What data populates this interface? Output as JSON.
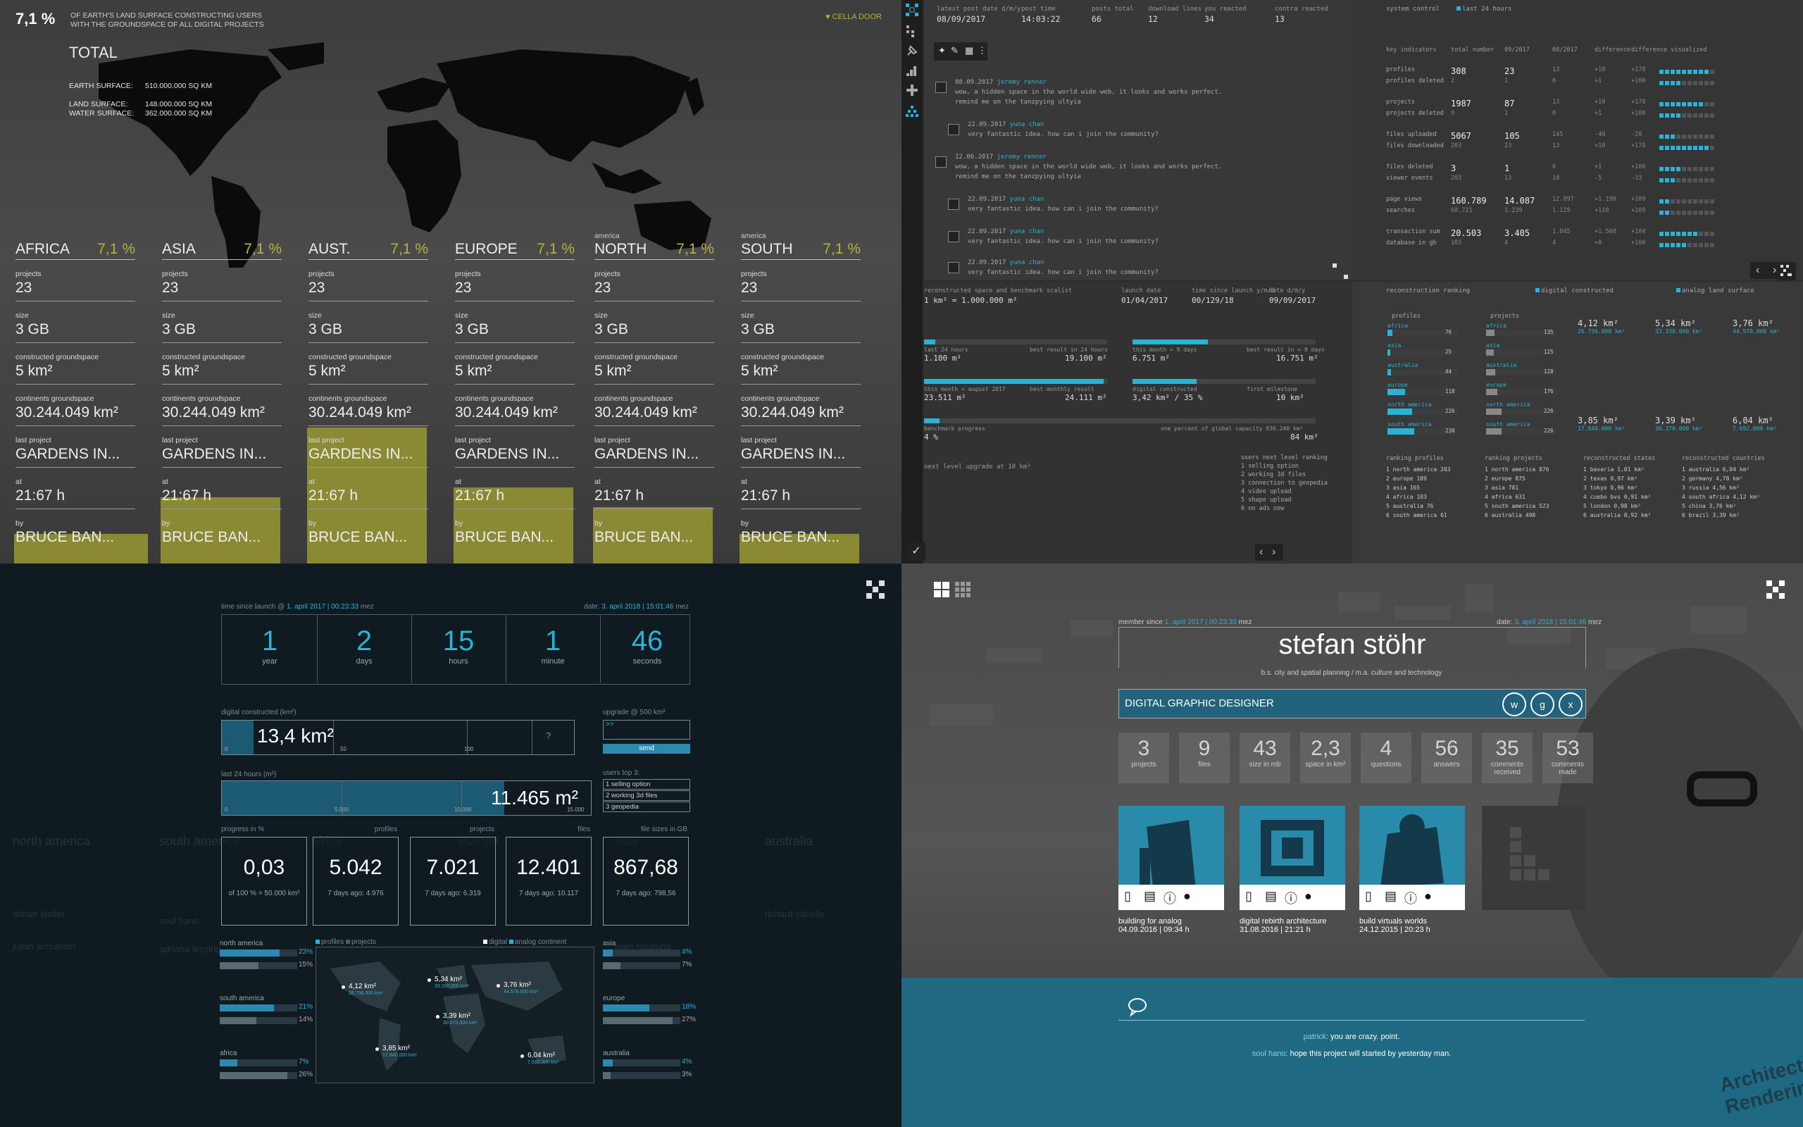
{
  "q1": {
    "pct": "7,1 %",
    "desc": [
      "OF EARTH'S LAND SURFACE CONSTRUCTING USERS",
      "WITH THE GROUNDSPACE OF ALL DIGITAL PROJECTS"
    ],
    "brand": "CELLA DOOR",
    "total": "TOTAL",
    "earth_label": "EARTH SURFACE:",
    "earth_val": "510.000.000 SQ KM",
    "land_label": "LAND SURFACE:",
    "land_val": "148.000.000 SQ KM",
    "water_label": "WATER SURFACE:",
    "water_val": "362.000.000 SQ KM",
    "continents": [
      {
        "pre": "",
        "name": "AFRICA",
        "pct": "7,1 %"
      },
      {
        "pre": "",
        "name": "ASIA",
        "pct": "7,1 %"
      },
      {
        "pre": "",
        "name": "AUST.",
        "pct": "7,1 %"
      },
      {
        "pre": "",
        "name": "EUROPE",
        "pct": "7,1 %"
      },
      {
        "pre": "america",
        "name": "NORTH",
        "pct": "7,1 %"
      },
      {
        "pre": "america",
        "name": "SOUTH",
        "pct": "7,1 %"
      }
    ],
    "fields": [
      {
        "label": "projects",
        "value": "23"
      },
      {
        "label": "size",
        "value": "3 GB"
      },
      {
        "label": "constructed groundspace",
        "value": "5 km²"
      },
      {
        "label": "continents groundspace",
        "value": "30.244.049 km²"
      },
      {
        "label": "last project",
        "value": "GARDENS IN..."
      },
      {
        "label": "at",
        "value": "21:67 h"
      },
      {
        "label": "by",
        "value": "BRUCE BAN..."
      }
    ],
    "bar_levels": [
      0.09,
      0.2,
      0.41,
      0.23,
      0.17,
      0.09
    ]
  },
  "q2": {
    "top_heads": [
      "latest post date d/m/y",
      "post time",
      "posts total",
      "download lines",
      "you reacted",
      "contra reacted"
    ],
    "top_vals": [
      "08/09/2017",
      "14:03:22",
      "66",
      "12",
      "34",
      "13"
    ],
    "messages": [
      {
        "date": "08.09.2017",
        "user": "jeremy renner",
        "text": "wow, a hidden space in the world wide web, it looks and works perfect.",
        "text2": "remind me on the tanzpying ultyia"
      },
      {
        "date": "22.09.2017",
        "user": "yuna chan",
        "text": "very fantastic idea. how can i join the community?",
        "text2": ""
      },
      {
        "date": "12.06.2017",
        "user": "jeremy renner",
        "text": "wow, a hidden space in the world wide web, it looks and works perfect.",
        "text2": "remind me on the tanzpying ultyia"
      },
      {
        "date": "22.09.2017",
        "user": "yuna chan",
        "text": "very fantastic idea. how can i join the community?",
        "text2": ""
      },
      {
        "date": "22.09.2017",
        "user": "yuna chan",
        "text": "very fantastic idea. how can i join the community?",
        "text2": ""
      },
      {
        "date": "22.09.2017",
        "user": "yuna chan",
        "text": "very fantastic idea. how can i join the community?",
        "text2": ""
      }
    ],
    "sys_control": "system control",
    "last_days": "last 24 hours",
    "table_heads": [
      "key indicators",
      "total number",
      "09/2017",
      "08/2017",
      "difference",
      "difference visualized"
    ],
    "table_rows": [
      {
        "k": "profiles",
        "t": "308",
        "a": "23",
        "b": "13",
        "d": "+10",
        "dv": "+178",
        "on": 9
      },
      {
        "k": "profiles deleted",
        "t": "2",
        "a": "1",
        "b": "0",
        "d": "+1",
        "dv": "+100",
        "on": 4
      },
      {
        "k": "projects",
        "t": "1987",
        "a": "87",
        "b": "13",
        "d": "+10",
        "dv": "+178",
        "on": 8
      },
      {
        "k": "projects deleted",
        "t": "9",
        "a": "1",
        "b": "0",
        "d": "+1",
        "dv": "+100",
        "on": 4
      },
      {
        "k": "files uploaded",
        "t": "5067",
        "a": "105",
        "b": "145",
        "d": "-40",
        "dv": "-28",
        "on": 3
      },
      {
        "k": "files downloaded",
        "t": "203",
        "a": "23",
        "b": "13",
        "d": "+10",
        "dv": "+178",
        "on": 9
      },
      {
        "k": "files deleted",
        "t": "3",
        "a": "1",
        "b": "0",
        "d": "+1",
        "dv": "+100",
        "on": 4
      },
      {
        "k": "viewer events",
        "t": "203",
        "a": "13",
        "b": "18",
        "d": "-5",
        "dv": "-33",
        "on": 3
      },
      {
        "k": "page views",
        "t": "160.789",
        "a": "14.087",
        "b": "12.897",
        "d": "+1.190",
        "dv": "+109",
        "on": 2
      },
      {
        "k": "searches",
        "t": "68.721",
        "a": "1.239",
        "b": "1.129",
        "d": "+110",
        "dv": "+109",
        "on": 2
      },
      {
        "k": "transaction sum",
        "t": "20.503",
        "a": "3.405",
        "b": "1.845",
        "d": "+1.560",
        "dv": "+184",
        "on": 7
      },
      {
        "k": "database in gb",
        "t": "103",
        "a": "4",
        "b": "4",
        "d": "+0",
        "dv": "+100",
        "on": 5
      }
    ],
    "bl_heads": [
      "reconstructed space and benchmark scalist",
      "launch date",
      "time since launch y/m/d",
      "date d/m/y"
    ],
    "bl_vals": [
      "1 km² = 1.000.000 m²",
      "01/04/2017",
      "00/129/18",
      "09/09/2017"
    ],
    "bl_rows": [
      {
        "l1": "last 24 hours",
        "r1": "best result in 24 hours",
        "v1": "1.100 m²",
        "w1": "19.100 m²",
        "l2": "this month = 9 days",
        "r2": "best result in = 9 days",
        "v2": "6.751 m²",
        "w2": "16.751 m²",
        "f1": 0.06,
        "f2": 0.41
      },
      {
        "l1": "this month = august 2017",
        "r1": "best monthly result",
        "v1": "23.511 m²",
        "w1": "24.111 m²",
        "l2": "digital constructed",
        "r2": "first milestone",
        "v2": "3,42 km² / 35 %",
        "w2": "10 km²",
        "f1": 0.98,
        "f2": 0.35
      }
    ],
    "benchmark_label": "benchmark progress",
    "benchmark_val": "4 %",
    "global_label": "one percent of global capacity 936.240 km²",
    "global_val": "84 km²",
    "next_upgrade": "next level upgrade at 10 km²",
    "users_ranking_title": "users next level ranking",
    "users_ranking": [
      "1 selling option",
      "2 working 3d files",
      "3 connection to geopedia",
      "4 video upload",
      "5 shape upload",
      "6 no ads now"
    ],
    "br_title": "reconstruction ranking",
    "legend": [
      "digital constructed",
      "analog land surface"
    ],
    "br_cols": [
      {
        "head": "profiles",
        "items": [
          {
            "n": "africa",
            "v": "76",
            "f": 0.07
          },
          {
            "n": "asia",
            "v": "25",
            "f": 0.04
          },
          {
            "n": "australia",
            "v": "44",
            "f": 0.05
          },
          {
            "n": "europe",
            "v": "118",
            "f": 0.25
          },
          {
            "n": "north america",
            "v": "226",
            "f": 0.35
          },
          {
            "n": "south america",
            "v": "230",
            "f": 0.38
          }
        ]
      },
      {
        "head": "projects",
        "items": [
          {
            "n": "africa",
            "v": "135",
            "f": 0.12
          },
          {
            "n": "asia",
            "v": "125",
            "f": 0.11
          },
          {
            "n": "australia",
            "v": "128",
            "f": 0.13
          },
          {
            "n": "europe",
            "v": "176",
            "f": 0.16
          },
          {
            "n": "north america",
            "v": "226",
            "f": 0.22
          },
          {
            "n": "south america",
            "v": "226",
            "f": 0.22
          }
        ]
      }
    ],
    "km_vals": [
      {
        "v": "4,12 km²",
        "s": "26.736.000 km²"
      },
      {
        "v": "5,34 km²",
        "s": "33.330.000 km²"
      },
      {
        "v": "3,76 km²",
        "s": "44.579.000 km²"
      },
      {
        "v": "3,85 km²",
        "s": "17.840.000 km²"
      },
      {
        "v": "3,39 km²",
        "s": "30.370.000 km²"
      },
      {
        "v": "6,04 km²",
        "s": "7.692.000 km²"
      }
    ],
    "rank_heads": [
      "ranking profiles",
      "ranking projects",
      "reconstructed states",
      "reconstructed countries"
    ],
    "ranks": [
      [
        "1 north america 203",
        "2 europe 189",
        "3 asia 165",
        "4 africa 103",
        "5 australia 76",
        "6 south america 61"
      ],
      [
        "1 north america 876",
        "2 europe 875",
        "3 asia 781",
        "4 africa 631",
        "5 south america 523",
        "6 australia 498"
      ],
      [
        "1 bavaria 1,01 km²",
        "2 texas 0,97 km²",
        "3 tokyo 0,96 km²",
        "4 cuebo bvs 0,91 km²",
        "5 london 0,98 km²",
        "6 australia 0,92 km²"
      ],
      [
        "1 australia 6,04 km²",
        "2 germany 4,78 km²",
        "3 russia 4,56 km²",
        "4 south africa 4,12 km²",
        "5 china 3,76 km²",
        "6 brazil 3,39 km²"
      ]
    ]
  },
  "q3": {
    "since_label": "time since launch @",
    "since_date": "1. april 2017 | 00:23:33",
    "since_tz": "mez",
    "date_label": "date:",
    "date_val": "3. april 2018 | 15:01:46",
    "date_tz": "mez",
    "timer": [
      {
        "n": "1",
        "u": "year"
      },
      {
        "n": "2",
        "u": "days"
      },
      {
        "n": "15",
        "u": "hours"
      },
      {
        "n": "1",
        "u": "minute"
      },
      {
        "n": "46",
        "u": "seconds"
      }
    ],
    "dc_label": "digital constructed (km²)",
    "dc_value": "13,4 km²",
    "dc_ticks": [
      "0",
      "50",
      "100"
    ],
    "dc_q": "?",
    "upg_label": "upgrade @ 500 km²",
    "upg_arrow": ">>",
    "send": "send",
    "l24_label": "last 24 hours (m²)",
    "l24_value": "11.465 m²",
    "l24_ticks": [
      "0",
      "5.000",
      "10.000",
      "15.000"
    ],
    "users_top_label": "users top 3:",
    "users_top": [
      "1 selling option",
      "2 working 3d files",
      "3 geopedia"
    ],
    "card_heads": [
      {
        "l": "progress in %",
        "r": ""
      },
      {
        "l": "",
        "r": "profiles"
      },
      {
        "l": "",
        "r": "projects"
      },
      {
        "l": "",
        "r": "files"
      },
      {
        "l": "",
        "r": "file sizes in GB"
      }
    ],
    "cards": [
      {
        "n": "0,03",
        "s": "of 100 % = 50.000 km²"
      },
      {
        "n": "5.042",
        "s": "7 days ago: 4.976"
      },
      {
        "n": "7.021",
        "s": "7 days ago: 6.319"
      },
      {
        "n": "12.401",
        "s": "7 days ago: 10.117"
      },
      {
        "n": "867,68",
        "s": "7 days ago: 798,56"
      }
    ],
    "bg_regions": [
      "north america",
      "south america",
      "africa",
      "europe",
      "asia",
      "australia"
    ],
    "bg_names": [
      "adrian kistler",
      "soul hano",
      "adriana lessing",
      "richard cabello",
      "julian schulman",
      "sven hausung"
    ],
    "legend_left": [
      "profiles",
      "projects"
    ],
    "legend_right": [
      "digital",
      "analog continent"
    ],
    "left_bars": [
      {
        "n": "north america",
        "p": "23%",
        "q": "15%",
        "f": 0.23,
        "g": 0.15
      },
      {
        "n": "south america",
        "p": "21%",
        "q": "14%",
        "f": 0.21,
        "g": 0.14
      },
      {
        "n": "africa",
        "p": "7%",
        "q": "26%",
        "f": 0.07,
        "g": 0.26
      }
    ],
    "right_bars": [
      {
        "n": "asia",
        "p": "4%",
        "q": "7%",
        "f": 0.04,
        "g": 0.07
      },
      {
        "n": "europe",
        "p": "18%",
        "q": "27%",
        "f": 0.18,
        "g": 0.27
      },
      {
        "n": "australia",
        "p": "4%",
        "q": "3%",
        "f": 0.04,
        "g": 0.03
      }
    ],
    "map_vals": [
      {
        "v": "4,12 km²",
        "s": "26.736.000 km²"
      },
      {
        "v": "5,34 km²",
        "s": "33.330.000 km²"
      },
      {
        "v": "3,76 km²",
        "s": "44.579.000 km²"
      },
      {
        "v": "3,39 km²",
        "s": "30.370.000 km²"
      },
      {
        "v": "3,85 km²",
        "s": "17.840.000 km²"
      },
      {
        "v": "6,04 km²",
        "s": "7.692.000 km²"
      }
    ]
  },
  "q4": {
    "member_label": "member since",
    "member_date": "1. april 2017 | 00:23:33",
    "member_tz": "mez",
    "date_label": "date:",
    "date_val": "3. april 2018 | 15:01:46",
    "date_tz": "mez",
    "name": "stefan stöhr",
    "subtitle": "b.s. city and spatial planning / m.a. culture and technology",
    "role": "DIGITAL GRAPHIC DESIGNER",
    "socials": [
      "w",
      "g",
      "x"
    ],
    "stats": [
      {
        "n": "3",
        "s": "projects"
      },
      {
        "n": "9",
        "s": "files"
      },
      {
        "n": "43",
        "s": "size in mb"
      },
      {
        "n": "2,3",
        "s": "space in km²"
      },
      {
        "n": "4",
        "s": "questions"
      },
      {
        "n": "56",
        "s": "answers"
      },
      {
        "n": "35",
        "s": "comments received"
      },
      {
        "n": "53",
        "s": "comments made"
      }
    ],
    "projects": [
      {
        "title": "building for analog",
        "date": "04.09.2016 | 09:34 h"
      },
      {
        "title": "digital rebirth architecture",
        "date": "31.08.2016 | 21:21 h"
      },
      {
        "title": "build virtuals worlds",
        "date": "24.12.2015 | 20:23 h"
      }
    ],
    "comments": [
      {
        "user": "patrick:",
        "text": "you are crazy. point."
      },
      {
        "user": "soul hano:",
        "text": "hope this project will started by yesterday man."
      }
    ],
    "book_text": "Architectural Renderings"
  }
}
